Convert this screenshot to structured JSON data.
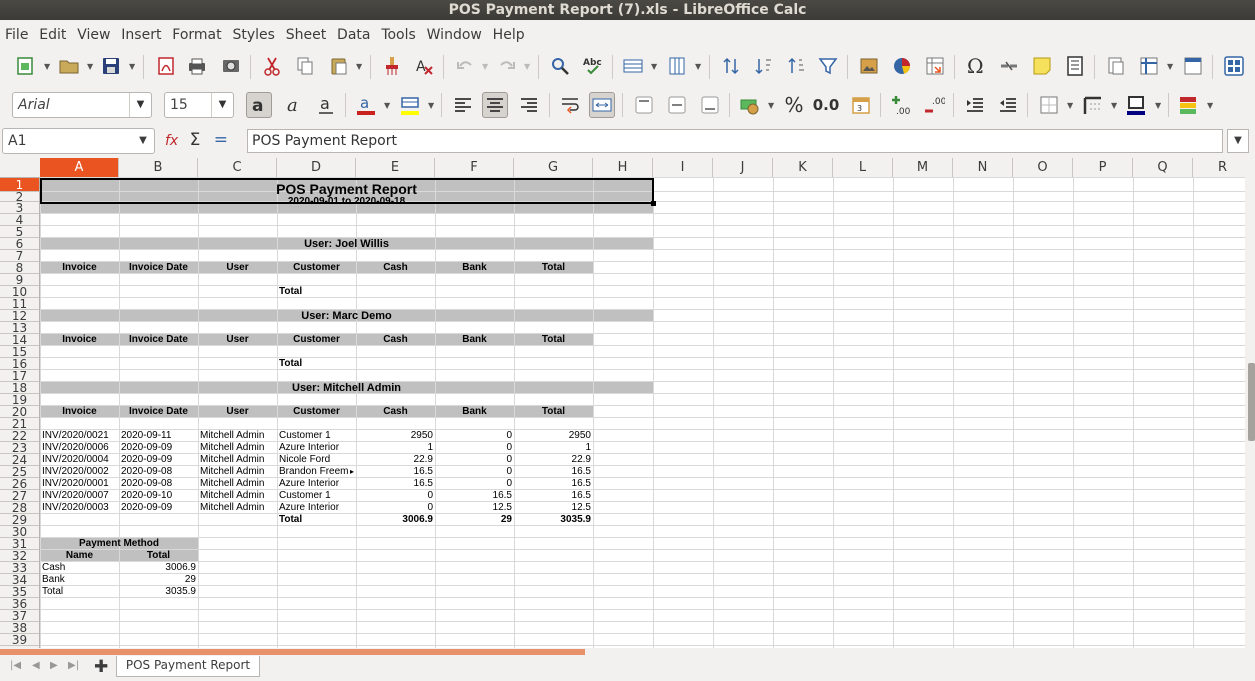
{
  "window": {
    "title": "POS Payment Report (7).xls - LibreOffice Calc"
  },
  "menu": [
    "File",
    "Edit",
    "View",
    "Insert",
    "Format",
    "Styles",
    "Sheet",
    "Data",
    "Tools",
    "Window",
    "Help"
  ],
  "format_bar": {
    "font_name": "Arial",
    "font_size": "15",
    "percent_label": "%",
    "decimal_label": "0.0"
  },
  "formula_bar": {
    "cell_ref": "A1",
    "content": "POS Payment Report"
  },
  "columns": [
    "A",
    "B",
    "C",
    "D",
    "E",
    "F",
    "G",
    "H",
    "I",
    "J",
    "K",
    "L",
    "M",
    "N",
    "O",
    "P",
    "Q",
    "R"
  ],
  "rows": [
    "1",
    "2",
    "3",
    "4",
    "5",
    "6",
    "7",
    "8",
    "9",
    "10",
    "11",
    "12",
    "13",
    "14",
    "15",
    "16",
    "17",
    "18",
    "19",
    "20",
    "21",
    "22",
    "23",
    "24",
    "25",
    "26",
    "27",
    "28",
    "29",
    "30",
    "31",
    "32",
    "33",
    "34",
    "35",
    "36",
    "37",
    "38",
    "39"
  ],
  "report": {
    "title": "POS Payment Report",
    "date_range": "2020-09-01 to 2020-09-18",
    "headers": [
      "Invoice",
      "Invoice Date",
      "User",
      "Customer",
      "Cash",
      "Bank",
      "Total"
    ],
    "total_label": "Total",
    "users": [
      {
        "name": "User: Joel Willis"
      },
      {
        "name": "User: Marc Demo"
      },
      {
        "name": "User: Mitchell Admin"
      }
    ],
    "lines": [
      [
        "INV/2020/0021",
        "2020-09-11",
        "Mitchell Admin",
        "Customer 1",
        "2950",
        "0",
        "2950"
      ],
      [
        "INV/2020/0006",
        "2020-09-09",
        "Mitchell Admin",
        "Azure Interior",
        "1",
        "0",
        "1"
      ],
      [
        "INV/2020/0004",
        "2020-09-09",
        "Mitchell Admin",
        "Nicole Ford",
        "22.9",
        "0",
        "22.9"
      ],
      [
        "INV/2020/0002",
        "2020-09-08",
        "Mitchell Admin",
        "Brandon Freem",
        "16.5",
        "0",
        "16.5"
      ],
      [
        "INV/2020/0001",
        "2020-09-08",
        "Mitchell Admin",
        "Azure Interior",
        "16.5",
        "0",
        "16.5"
      ],
      [
        "INV/2020/0007",
        "2020-09-10",
        "Mitchell Admin",
        "Customer 1",
        "0",
        "16.5",
        "16.5"
      ],
      [
        "INV/2020/0003",
        "2020-09-09",
        "Mitchell Admin",
        "Azure Interior",
        "0",
        "12.5",
        "12.5"
      ]
    ],
    "mitchell_totals": {
      "cash": "3006.9",
      "bank": "29",
      "total": "3035.9"
    },
    "payment_method": {
      "title": "Payment Method",
      "name_header": "Name",
      "total_header": "Total",
      "rows": [
        [
          "Cash",
          "3006.9"
        ],
        [
          "Bank",
          "29"
        ],
        [
          "Total",
          "3035.9"
        ]
      ]
    }
  },
  "sheet_tab": "POS Payment Report"
}
